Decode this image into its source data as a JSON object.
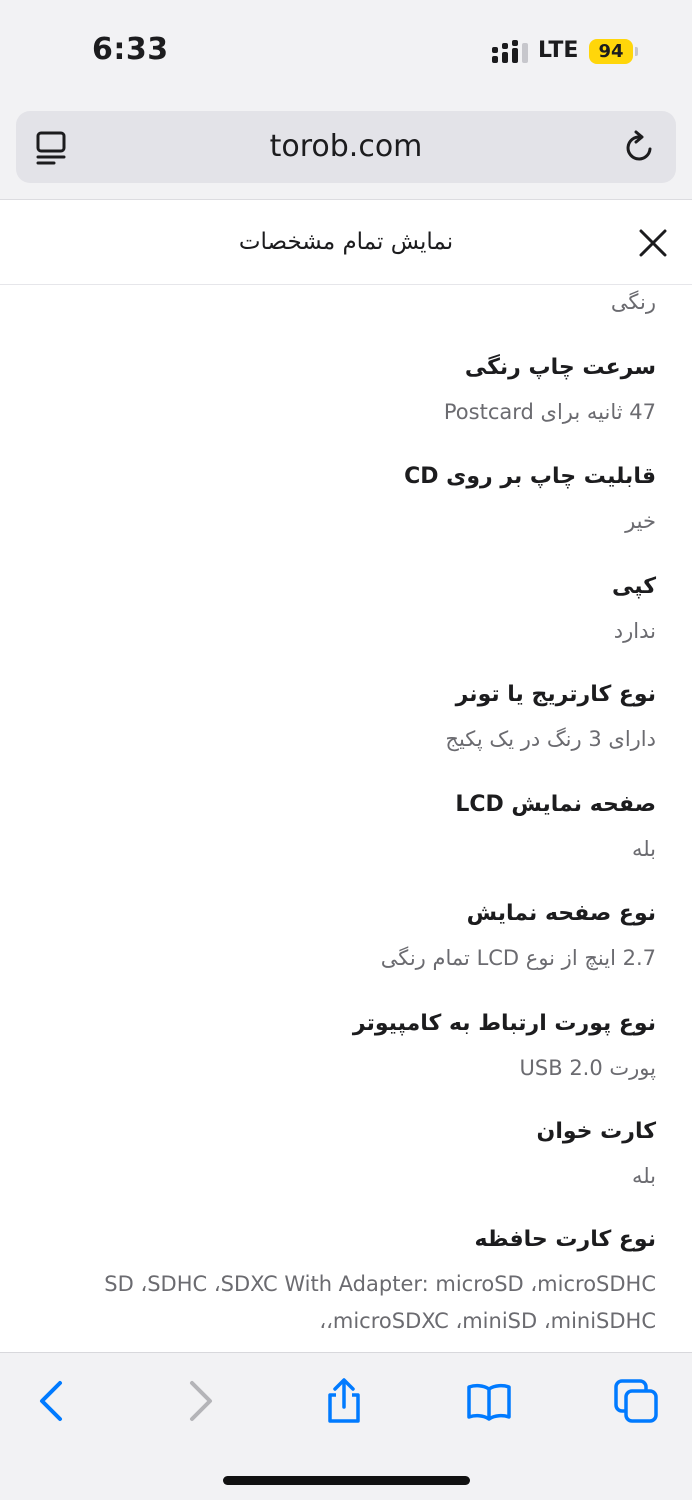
{
  "status_bar": {
    "time": "6:33",
    "network": "LTE",
    "battery": "94",
    "battery_color": "#ffd60a"
  },
  "browser": {
    "url": "torob.com",
    "reader_icon": "reader-icon",
    "reload_icon": "reload-icon",
    "accent_color": "#007aff"
  },
  "sheet": {
    "title": "نمایش تمام مشخصات",
    "close_icon": "close-icon"
  },
  "specs": {
    "cut_off_value": "رنگی",
    "items": [
      {
        "label": "سرعت چاپ رنگی",
        "value": "47 ثانیه برای Postcard"
      },
      {
        "label": "قابلیت چاپ بر روی CD",
        "value": "خیر"
      },
      {
        "label": "کپی",
        "value": "ندارد"
      },
      {
        "label": "نوع کارتریج یا تونر",
        "value": "دارای 3 رنگ در یک پکیج"
      },
      {
        "label": "صفحه نمایش LCD",
        "value": "بله"
      },
      {
        "label": "نوع صفحه نمایش",
        "value": "2.7 اینچ از نوع LCD تمام رنگی"
      },
      {
        "label": "نوع پورت ارتباط به کامپیوتر",
        "value": "پورت USB 2.0"
      },
      {
        "label": "کارت خوان",
        "value": "بله"
      },
      {
        "label": "نوع کارت حافظه",
        "value": "SD ،SDHC ،SDXC With Adapter: microSD ،microSDHC ،microSDXC ،miniSD ،miniSDHC،"
      }
    ]
  },
  "toolbar": {
    "back": "back-chevron-icon",
    "forward": "forward-chevron-icon",
    "share": "share-icon",
    "bookmarks": "bookmarks-icon",
    "tabs": "tabs-icon"
  }
}
